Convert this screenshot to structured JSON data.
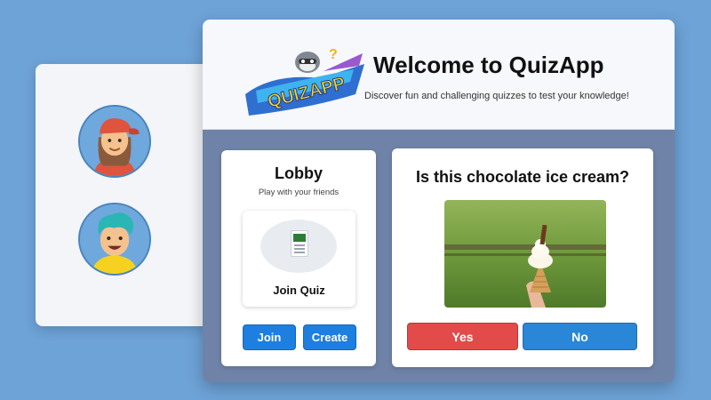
{
  "header": {
    "title": "Welcome to QuizApp",
    "subtitle": "Discover fun and challenging quizzes to test your knowledge!",
    "logo_text": "QUIZAPP"
  },
  "lobby": {
    "title": "Lobby",
    "subtitle": "Play with your friends",
    "tile_label": "Join Quiz",
    "join_label": "Join",
    "create_label": "Create"
  },
  "question": {
    "text": "Is this chocolate ice cream?",
    "yes_label": "Yes",
    "no_label": "No"
  },
  "icons": {
    "logo": "raccoon-mascot-logo",
    "tile": "document-icon",
    "avatars": [
      "avatar-girl-red-cap",
      "avatar-boy-teal-hair"
    ]
  },
  "colors": {
    "background": "#6ea3d8",
    "yes_button": "#e34b4b",
    "no_button": "#2a86d6",
    "primary_button": "#1d7fe0",
    "main_panel": "#6f83a8"
  }
}
